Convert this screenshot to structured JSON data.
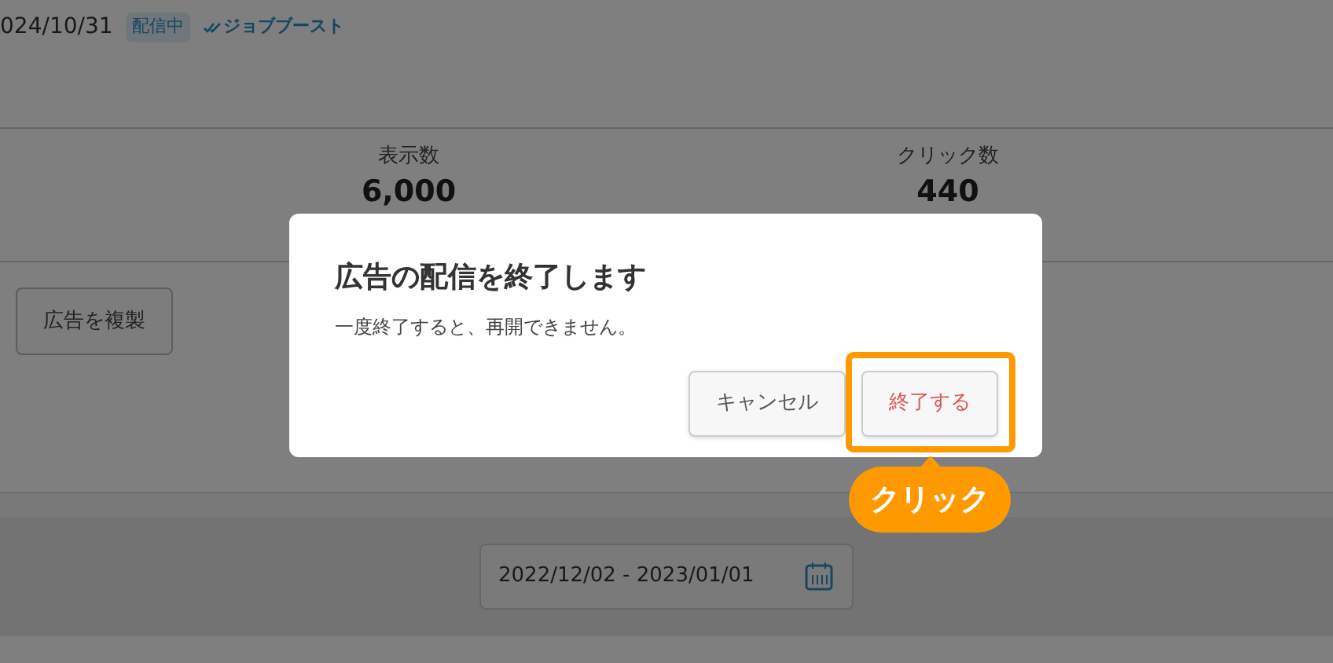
{
  "header": {
    "date": "024/10/31",
    "status_badge": "配信中",
    "boost_label": "ジョブブースト"
  },
  "stats": [
    {
      "label": "表示数",
      "value": "6,000"
    },
    {
      "label": "クリック数",
      "value": "440"
    }
  ],
  "actions": [
    {
      "label": "広告を複製"
    }
  ],
  "date_range": {
    "value": "2022/12/02 - 2023/01/01"
  },
  "dialog": {
    "title": "広告の配信を終了します",
    "message": "一度終了すると、再開できません。",
    "buttons": [
      {
        "label": "キャンセル",
        "kind": "cancel",
        "highlighted": false
      },
      {
        "label": "終了する",
        "kind": "danger",
        "highlighted": true
      }
    ]
  },
  "callout": {
    "label": "クリック"
  }
}
